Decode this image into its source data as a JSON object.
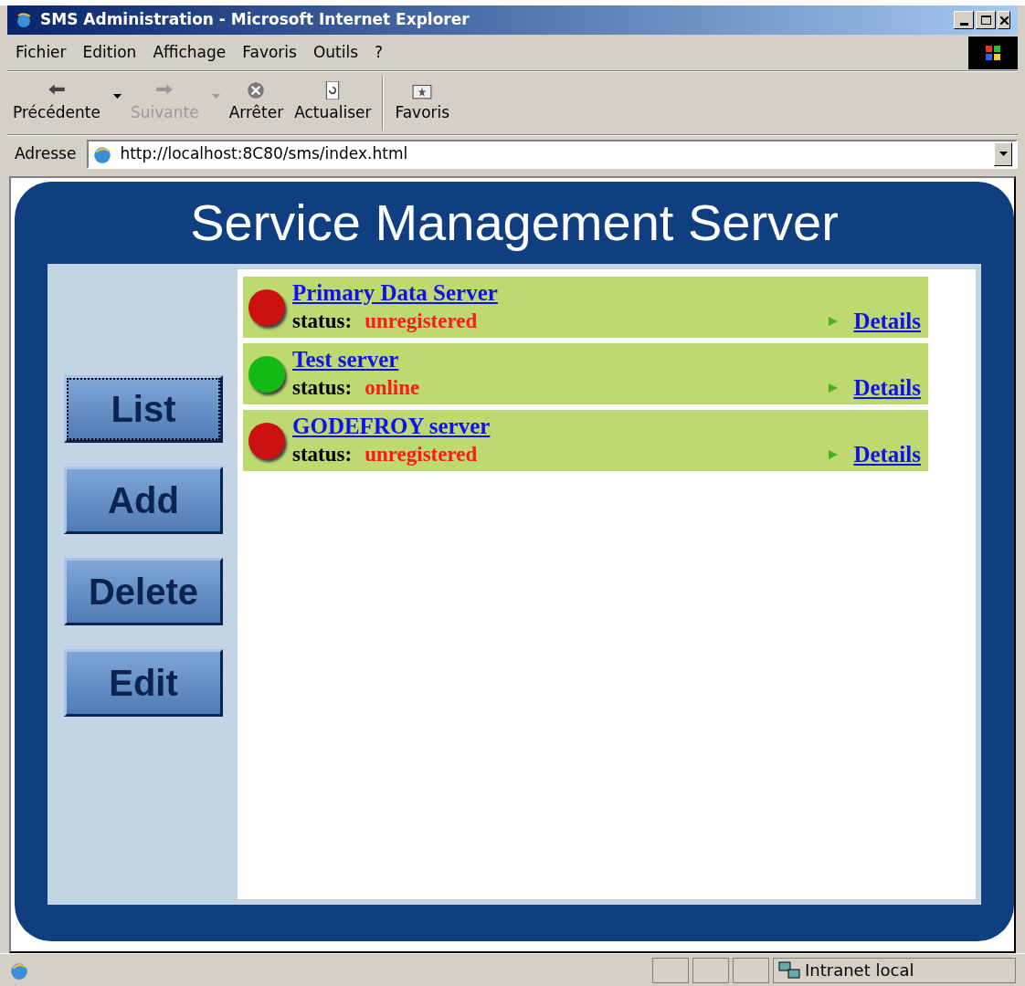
{
  "window": {
    "title": "SMS Administration - Microsoft Internet Explorer"
  },
  "menu": [
    "Fichier",
    "Edition",
    "Affichage",
    "Favoris",
    "Outils",
    "?"
  ],
  "toolbar": [
    {
      "label": "Précédente",
      "kind": "back",
      "disabled": false,
      "has_menu": true
    },
    {
      "label": "Suivante",
      "kind": "forward",
      "disabled": true,
      "has_menu": true
    },
    {
      "label": "Arrêter",
      "kind": "stop",
      "disabled": false,
      "has_menu": false
    },
    {
      "label": "Actualiser",
      "kind": "refresh",
      "disabled": false,
      "has_menu": false
    },
    {
      "label": "Favoris",
      "kind": "favorites",
      "disabled": false,
      "has_menu": false
    }
  ],
  "address": {
    "label": "Adresse",
    "value": "http://localhost:8C80/sms/index.html"
  },
  "page": {
    "heading": "Service Management Server",
    "nav": [
      {
        "label": "List",
        "selected": true
      },
      {
        "label": "Add",
        "selected": false
      },
      {
        "label": "Delete",
        "selected": false
      },
      {
        "label": "Edit",
        "selected": false
      }
    ],
    "servers": [
      {
        "name": "Primary Data Server",
        "status_label": "status:",
        "status": "unregistered",
        "color": "#cc1111",
        "link": "Details"
      },
      {
        "name": "Test server",
        "status_label": "status:",
        "status": "online",
        "color": "#11bb11",
        "link": "Details"
      },
      {
        "name": "GODEFROY server",
        "status_label": "status:",
        "status": "unregistered",
        "color": "#cc1111",
        "link": "Details"
      }
    ]
  },
  "status_bar": {
    "zone": "Intranet local"
  }
}
